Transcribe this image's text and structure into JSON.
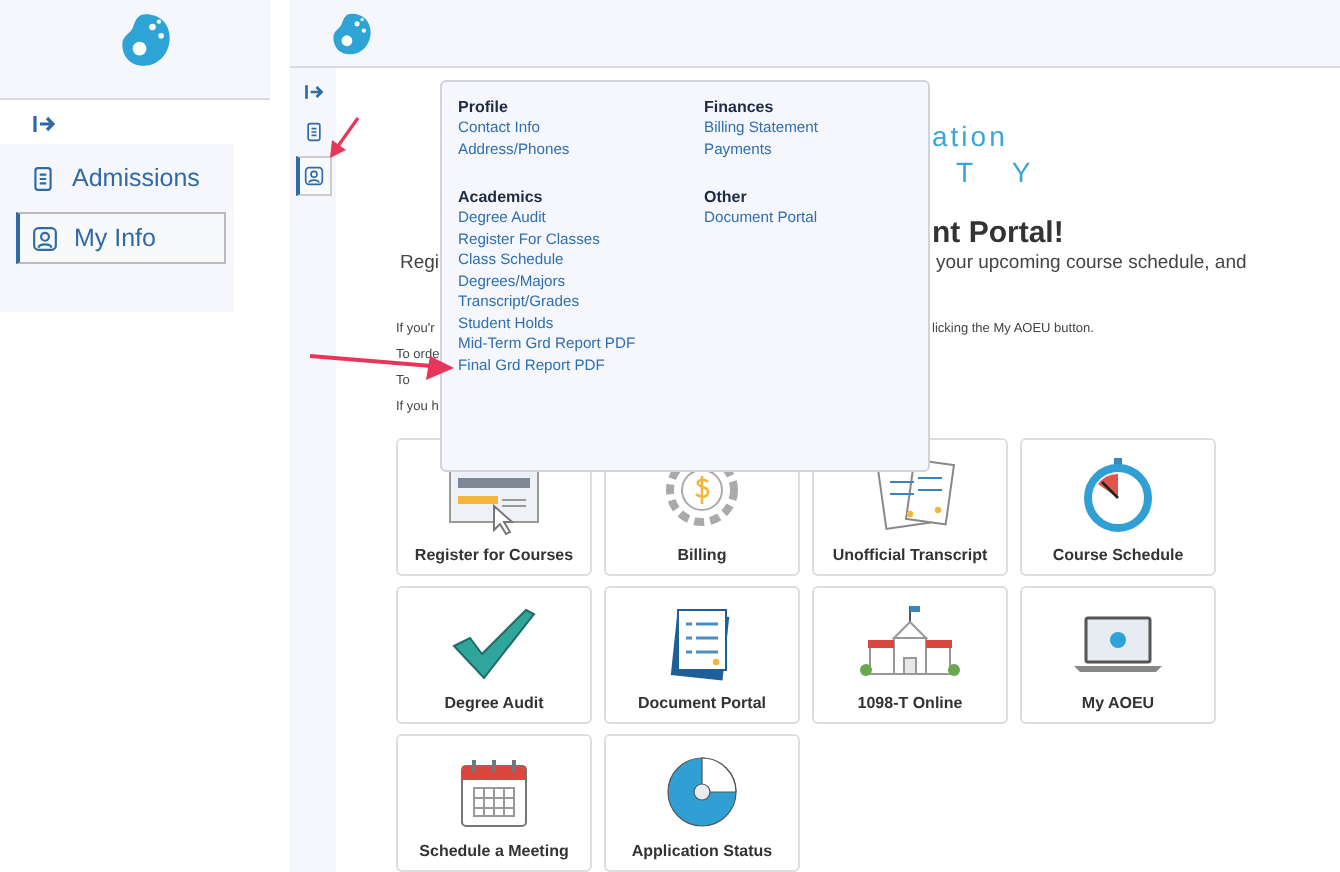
{
  "sidebar": {
    "items": [
      {
        "label": "Admissions",
        "kind": "document",
        "selected": false
      },
      {
        "label": "My Info",
        "kind": "person",
        "selected": true
      }
    ]
  },
  "rail": {
    "items": [
      {
        "kind": "expand",
        "selected": false
      },
      {
        "kind": "document",
        "selected": false
      },
      {
        "kind": "person",
        "selected": true
      }
    ]
  },
  "content": {
    "logo_lines": [
      "ation",
      "T Y"
    ],
    "heading": "nt Portal!",
    "intro": {
      "left": "Regi",
      "right": "your upcoming course schedule, and"
    },
    "notes": [
      {
        "left": "If you'r",
        "right": "licking the My AOEU button."
      },
      {
        "left": "To orde"
      },
      {
        "left": "To"
      },
      {
        "left": "If you h"
      }
    ]
  },
  "menu": {
    "columns": [
      {
        "sections": [
          {
            "title": "Profile",
            "links": [
              "Contact Info",
              "Address/Phones"
            ]
          },
          {
            "title": "Academics",
            "links": [
              "Degree Audit",
              "Register For Classes",
              "Class Schedule",
              "Degrees/Majors",
              "Transcript/Grades",
              "Student Holds",
              "Mid-Term Grd Report PDF",
              "Final Grd Report PDF"
            ]
          }
        ]
      },
      {
        "sections": [
          {
            "title": "Finances",
            "links": [
              "Billing Statement",
              "Payments"
            ]
          },
          {
            "title": "Other",
            "links": [
              "Document Portal"
            ]
          }
        ]
      }
    ]
  },
  "tiles": [
    {
      "label": "Register for Courses",
      "kind": "register"
    },
    {
      "label": "Billing",
      "kind": "billing"
    },
    {
      "label": "Unofficial Transcript",
      "kind": "transcript"
    },
    {
      "label": "Course Schedule",
      "kind": "stopwatch"
    },
    {
      "label": "Degree Audit",
      "kind": "check"
    },
    {
      "label": "Document Portal",
      "kind": "documents"
    },
    {
      "label": "1098-T Online",
      "kind": "school"
    },
    {
      "label": "My AOEU",
      "kind": "laptop"
    },
    {
      "label": "Schedule a Meeting",
      "kind": "calendar"
    },
    {
      "label": "Application Status",
      "kind": "pie"
    }
  ]
}
